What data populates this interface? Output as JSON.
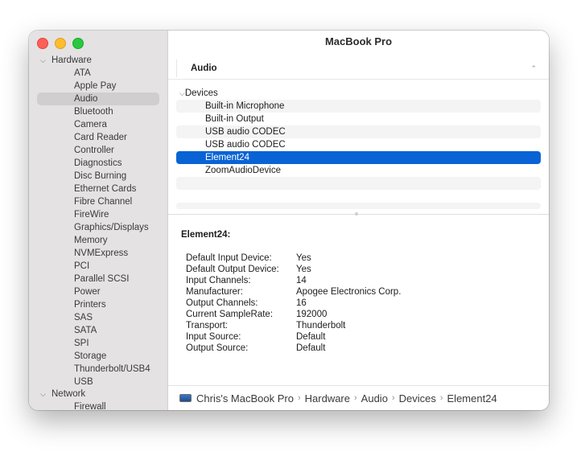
{
  "window": {
    "title": "MacBook Pro"
  },
  "sidebar": {
    "groups": [
      {
        "label": "Hardware",
        "expanded": true,
        "items": [
          "ATA",
          "Apple Pay",
          "Audio",
          "Bluetooth",
          "Camera",
          "Card Reader",
          "Controller",
          "Diagnostics",
          "Disc Burning",
          "Ethernet Cards",
          "Fibre Channel",
          "FireWire",
          "Graphics/Displays",
          "Memory",
          "NVMExpress",
          "PCI",
          "Parallel SCSI",
          "Power",
          "Printers",
          "SAS",
          "SATA",
          "SPI",
          "Storage",
          "Thunderbolt/USB4",
          "USB"
        ],
        "selected": "Audio"
      },
      {
        "label": "Network",
        "expanded": true,
        "items": [
          "Firewall"
        ]
      }
    ]
  },
  "section": {
    "title": "Audio"
  },
  "tree": {
    "root": "Devices",
    "children": [
      "Built-in Microphone",
      "Built-in Output",
      "USB audio CODEC",
      "USB audio CODEC",
      "Element24",
      "ZoomAudioDevice"
    ],
    "selected_index": 4
  },
  "detail": {
    "title": "Element24:",
    "properties": [
      {
        "key": "Default Input Device:",
        "value": "Yes"
      },
      {
        "key": "Default Output Device:",
        "value": "Yes"
      },
      {
        "key": "Input Channels:",
        "value": "14"
      },
      {
        "key": "Manufacturer:",
        "value": "Apogee Electronics Corp."
      },
      {
        "key": "Output Channels:",
        "value": "16"
      },
      {
        "key": "Current SampleRate:",
        "value": "192000"
      },
      {
        "key": "Transport:",
        "value": "Thunderbolt"
      },
      {
        "key": "Input Source:",
        "value": "Default"
      },
      {
        "key": "Output Source:",
        "value": "Default"
      }
    ]
  },
  "path": {
    "segments": [
      "Chris's MacBook Pro",
      "Hardware",
      "Audio",
      "Devices",
      "Element24"
    ],
    "separator": "›"
  },
  "colors": {
    "selection": "#0a63d4",
    "sidebar_bg": "#e4e2e3",
    "sidebar_selected": "#d0cecf",
    "close": "#fe5f57",
    "minimize": "#febc2e",
    "zoom": "#28c840"
  },
  "icons": {
    "group_chevron": "⌵",
    "section_chevron": "⌃"
  }
}
